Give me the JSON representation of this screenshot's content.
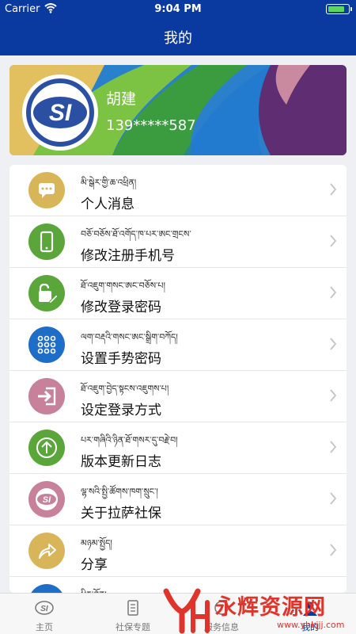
{
  "status_bar": {
    "carrier": "Carrier",
    "time": "9:04 PM",
    "battery_level": 0.85
  },
  "header": {
    "title": "我的"
  },
  "profile": {
    "name": "胡建",
    "phone": "139*****587",
    "logo_text": "SI"
  },
  "menu": [
    {
      "tibetan": "མི་སྒེར་གྱི་ཆ་འཕྲིན།",
      "label": "个人消息",
      "icon": "message-icon",
      "color": "#d9b55a"
    },
    {
      "tibetan": "བཅོ་བཅོས་ཐོ་འགོད་ཁ་པར་ཨང་གྲངས་",
      "label": "修改注册手机号",
      "icon": "phone-icon",
      "color": "#5aa63a"
    },
    {
      "tibetan": "ཐོ་འཇུག་གསང་ཨང་བཅོས་པ།",
      "label": "修改登录密码",
      "icon": "edit-lock-icon",
      "color": "#5aa63a"
    },
    {
      "tibetan": "ལག་བརྡའི་གསང་ཨང་སྒྲིག་བཀོད།",
      "label": "设置手势密码",
      "icon": "gesture-grid-icon",
      "color": "#1e6ec8"
    },
    {
      "tibetan": "ཐོ་འཇུག་བྱེད་སྟངས་འཇུགས་པ།",
      "label": "设定登录方式",
      "icon": "login-icon",
      "color": "#c7819b"
    },
    {
      "tibetan": "པར་གཞིའི་ཉིན་ཐོ་གསར་དུ་བརྗེ་བ།",
      "label": "版本更新日志",
      "icon": "upload-arrow-icon",
      "color": "#5aa63a"
    },
    {
      "tibetan": "ལྷ་སའི་སྤྱི་ཚོགས་ཁག་སྲུང་།",
      "label": "关于拉萨社保",
      "icon": "si-logo-icon",
      "color": "#c7819b"
    },
    {
      "tibetan": "མཉམ་སྤྱོད།",
      "label": "分享",
      "icon": "share-icon",
      "color": "#d9b55a"
    },
    {
      "tibetan": "ཕྱིར་ཐོན།",
      "label": "",
      "icon": "partial-icon",
      "color": "#1e6ec8"
    }
  ],
  "tabbar": [
    {
      "label": "主页",
      "icon": "home-logo-icon",
      "active": false
    },
    {
      "label": "社保专题",
      "icon": "document-icon",
      "active": false
    },
    {
      "label": "服务信息",
      "icon": "service-icon",
      "active": false
    },
    {
      "label": "我的",
      "icon": "profile-icon",
      "active": true
    }
  ],
  "watermark": {
    "text": "永辉资源网",
    "url": "www.yhkjjj.com"
  }
}
